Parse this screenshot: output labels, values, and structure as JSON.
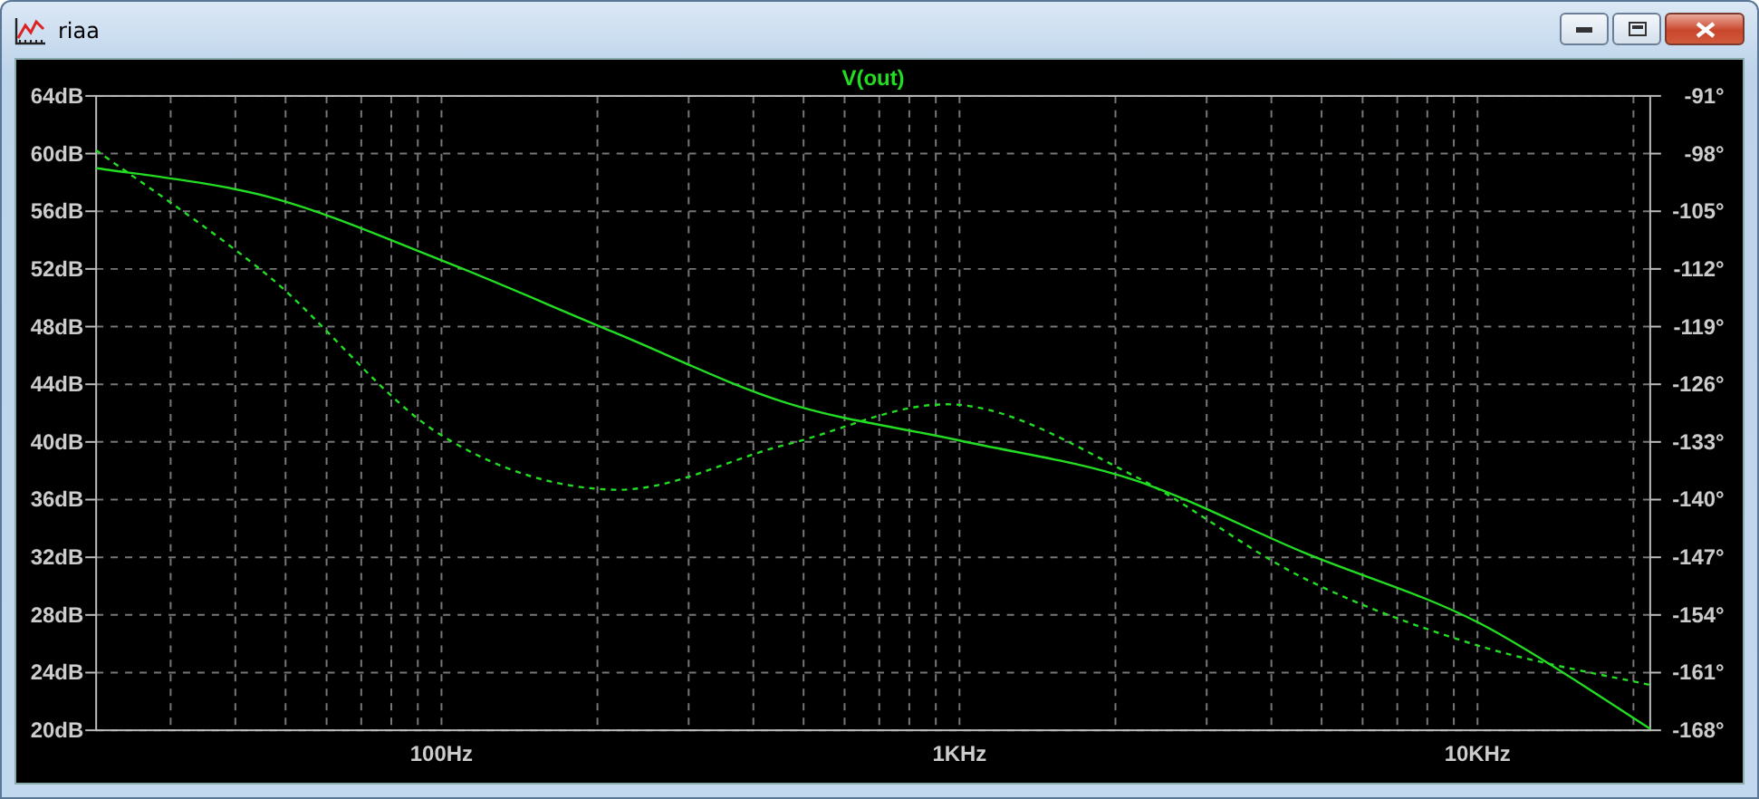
{
  "window": {
    "title": "riaa"
  },
  "title_buttons": [
    {
      "kind": "minimize"
    },
    {
      "kind": "maximize"
    },
    {
      "kind": "close"
    }
  ],
  "plot": {
    "chart_data": {
      "type": "line",
      "title": "V(out)",
      "grid": true,
      "categories": [
        null,
        null,
        "100Hz",
        null,
        null,
        "1KHz",
        null,
        null,
        "10KHz",
        null
      ],
      "ylim": [
        20,
        64
      ],
      "y2lim": [
        -168,
        -91
      ],
      "yticks": [
        {
          "value": 64,
          "label": "64dB"
        },
        {
          "value": 60,
          "label": "60dB"
        },
        {
          "value": 56,
          "label": "56dB"
        },
        {
          "value": 52,
          "label": "52dB"
        },
        {
          "value": 48,
          "label": "48dB"
        },
        {
          "value": 44,
          "label": "44dB"
        },
        {
          "value": 40,
          "label": "40dB"
        },
        {
          "value": 36,
          "label": "36dB"
        },
        {
          "value": 32,
          "label": "32dB"
        },
        {
          "value": 28,
          "label": "28dB"
        },
        {
          "value": 24,
          "label": "24dB"
        },
        {
          "value": 20,
          "label": "20dB"
        }
      ],
      "y2ticks": [
        {
          "value": -91,
          "label": "-91°"
        },
        {
          "value": -98,
          "label": "-98°"
        },
        {
          "value": -105,
          "label": "-105°"
        },
        {
          "value": -112,
          "label": "-112°"
        },
        {
          "value": -119,
          "label": "-119°"
        },
        {
          "value": -126,
          "label": "-126°"
        },
        {
          "value": -133,
          "label": "-133°"
        },
        {
          "value": -140,
          "label": "-140°"
        },
        {
          "value": -147,
          "label": "-147°"
        },
        {
          "value": -154,
          "label": "-154°"
        },
        {
          "value": -161,
          "label": "-161°"
        },
        {
          "value": -168,
          "label": "-168°"
        }
      ],
      "series": [
        {
          "color": "#22dd22",
          "line_style": "solid",
          "values": [
            59,
            57,
            52.6,
            47.6,
            42.7,
            40.1,
            37.4,
            32.3,
            27.5,
            20.1
          ]
        },
        {
          "color": "#22dd22",
          "axis": "y2",
          "line_style": "dashed",
          "values": [
            -97.6,
            -112.9,
            -132.2,
            -138.8,
            -133.3,
            -128.5,
            -137,
            -149.6,
            -157.7,
            -162.5
          ]
        }
      ]
    }
  }
}
